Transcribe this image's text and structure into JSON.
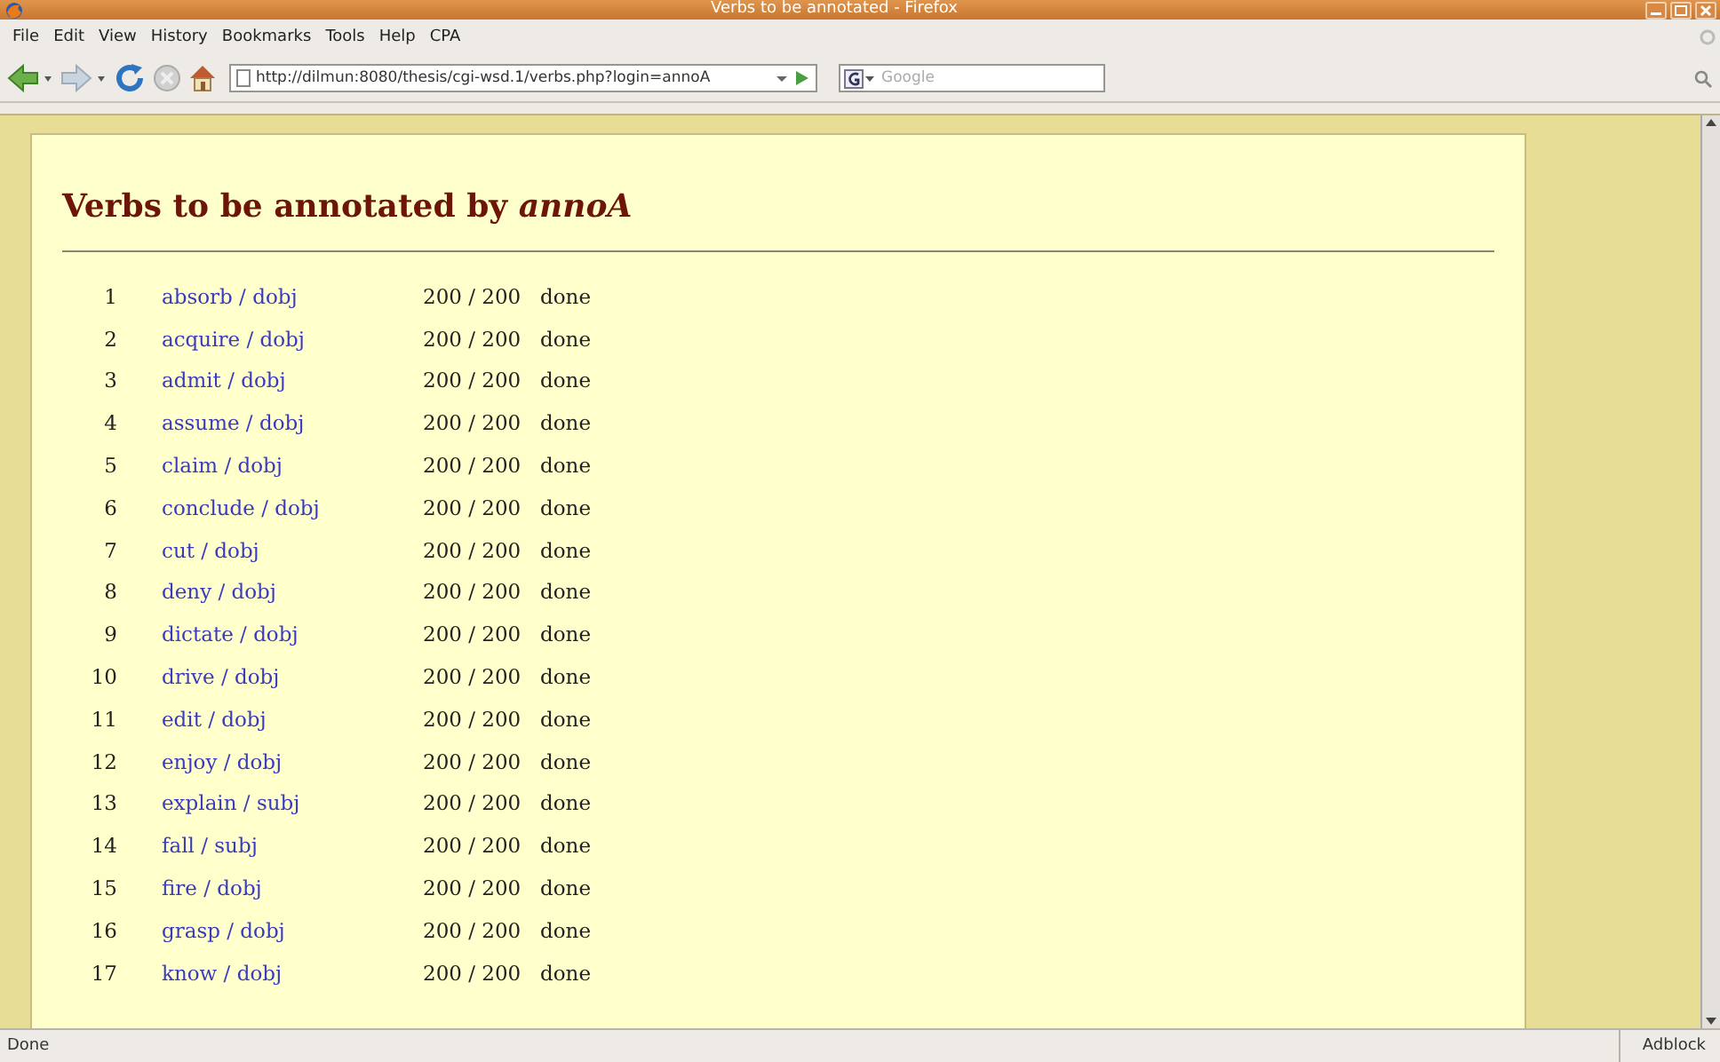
{
  "window": {
    "title": "Verbs to be annotated - Firefox"
  },
  "menu": [
    "File",
    "Edit",
    "View",
    "History",
    "Bookmarks",
    "Tools",
    "Help",
    "CPA"
  ],
  "address_bar": {
    "value": "http://dilmun:8080/thesis/cgi-wsd.1/verbs.php?login=annoA"
  },
  "search": {
    "placeholder": "Google"
  },
  "page": {
    "heading": "Verbs to be annotated by *annoA*",
    "rows": [
      {
        "number": "1",
        "verb": "absorb / dobj",
        "count": "200 / 200",
        "status": "done"
      },
      {
        "number": "2",
        "verb": "acquire / dobj",
        "count": "200 / 200",
        "status": "done"
      },
      {
        "number": "3",
        "verb": "admit / dobj",
        "count": "200 / 200",
        "status": "done"
      },
      {
        "number": "4",
        "verb": "assume / dobj",
        "count": "200 / 200",
        "status": "done"
      },
      {
        "number": "5",
        "verb": "claim / dobj",
        "count": "200 / 200",
        "status": "done"
      },
      {
        "number": "6",
        "verb": "conclude / dobj",
        "count": "200 / 200",
        "status": "done"
      },
      {
        "number": "7",
        "verb": "cut / dobj",
        "count": "200 / 200",
        "status": "done"
      },
      {
        "number": "8",
        "verb": "deny / dobj",
        "count": "200 / 200",
        "status": "done"
      },
      {
        "number": "9",
        "verb": "dictate / dobj",
        "count": "200 / 200",
        "status": "done"
      },
      {
        "number": "10",
        "verb": "drive / dobj",
        "count": "200 / 200",
        "status": "done"
      },
      {
        "number": "11",
        "verb": "edit / dobj",
        "count": "200 / 200",
        "status": "done"
      },
      {
        "number": "12",
        "verb": "enjoy / dobj",
        "count": "200 / 200",
        "status": "done"
      },
      {
        "number": "13",
        "verb": "explain / subj",
        "count": "200 / 200",
        "status": "done"
      },
      {
        "number": "14",
        "verb": "fall / subj",
        "count": "200 / 200",
        "status": "done"
      },
      {
        "number": "15",
        "verb": "fire / dobj",
        "count": "200 / 200",
        "status": "done"
      },
      {
        "number": "16",
        "verb": "grasp / dobj",
        "count": "200 / 200",
        "status": "done"
      },
      {
        "number": "17",
        "verb": "know / dobj",
        "count": "200 / 200",
        "status": "done"
      }
    ]
  },
  "status_bar": {
    "text": "Done",
    "addon": "Adblock"
  }
}
